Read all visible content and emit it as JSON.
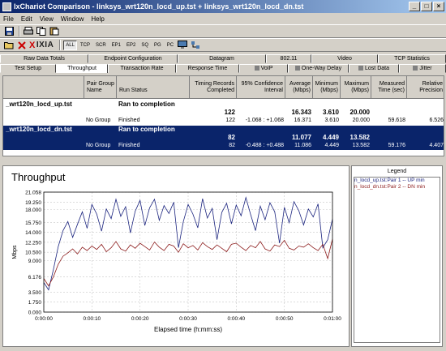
{
  "window": {
    "title": "IxChariot Comparison - linksys_wrt120n_locd_up.tst + linksys_wrt120n_locd_dn.tst",
    "minimize": "_",
    "maximize": "□",
    "close": "×"
  },
  "menu": [
    "File",
    "Edit",
    "View",
    "Window",
    "Help"
  ],
  "toolbar": {
    "brand_x": "X",
    "brand": "IXIA",
    "filters": [
      "ALL",
      "TCP",
      "SCR",
      "EP1",
      "EP2",
      "SQ",
      "PG",
      "PC"
    ]
  },
  "tabs_row1": [
    "Raw Data Totals",
    "Endpoint Configuration",
    "Datagram",
    "802.11",
    "Video",
    "TCP Statistics"
  ],
  "tabs_row2": [
    "Test Setup",
    "Throughput",
    "Transaction Rate",
    "Response Time",
    "VoIP",
    "One-Way Delay",
    "Lost Data",
    "Jitter"
  ],
  "grid": {
    "headers": {
      "pair_group": [
        "Pair Group",
        "Name"
      ],
      "run_status": "Run Status",
      "timing": [
        "Timing Records",
        "Completed"
      ],
      "confidence": [
        "95% Confidence",
        "Interval"
      ],
      "average": [
        "Average",
        "(Mbps)"
      ],
      "minimum": [
        "Minimum",
        "(Mbps)"
      ],
      "maximum": [
        "Maximum",
        "(Mbps)"
      ],
      "measured": [
        "Measured",
        "Time (sec)"
      ],
      "relative": [
        "Relative",
        "Precision"
      ]
    },
    "files": [
      {
        "name": "_wrt120n_locd_up.tst",
        "status": "Ran to completion",
        "total_records": "122",
        "total_avg": "16.343",
        "total_min": "3.610",
        "total_max": "20.000",
        "pair": {
          "group": "No Group",
          "status": "Finished",
          "records": "122",
          "conf": "-1.068 : +1.068",
          "avg": "16.371",
          "min": "3.610",
          "max": "20.000",
          "time": "59.618",
          "prec": "6.526"
        }
      },
      {
        "name": "_wrt120n_locd_dn.tst",
        "status": "Ran to completion",
        "total_records": "82",
        "total_avg": "11.077",
        "total_min": "4.449",
        "total_max": "13.582",
        "pair": {
          "group": "No Group",
          "status": "Finished",
          "records": "82",
          "conf": "-0.488 : +0.488",
          "avg": "11.086",
          "min": "4.449",
          "max": "13.582",
          "time": "59.176",
          "prec": "4.407"
        }
      }
    ]
  },
  "legend": {
    "title": "Legend",
    "items": [
      {
        "label": "n_locd_up.tst:Pair 1 -- UP min",
        "color": "#1a237e"
      },
      {
        "label": "n_locd_dn.tst:Pair 2 -- DN min",
        "color": "#8b1a1a"
      }
    ]
  },
  "chart_data": {
    "type": "line",
    "title": "Throughput",
    "xlabel": "Elapsed time (h:mm:ss)",
    "ylabel": "Mbps",
    "xlim": [
      0,
      60
    ],
    "ylim": [
      0,
      21.058
    ],
    "yticks": [
      "0.000",
      "1.750",
      "3.500",
      "6.176",
      "9.000",
      "10.500",
      "12.250",
      "14.000",
      "15.750",
      "18.000",
      "19.250",
      "21.058"
    ],
    "ytick_values": [
      0,
      1.75,
      3.5,
      6.176,
      9.0,
      10.5,
      12.25,
      14.0,
      15.75,
      18.0,
      19.25,
      21.058
    ],
    "xticks": [
      "0:00:00",
      "0:00:10",
      "0:00:20",
      "0:00:30",
      "0:00:40",
      "0:00:50",
      "0:01:00"
    ],
    "xtick_values": [
      0,
      10,
      20,
      30,
      40,
      50,
      60
    ],
    "series": [
      {
        "color": "#1a237e",
        "x": [
          0,
          1,
          2,
          3,
          4,
          5,
          6,
          7,
          8,
          9,
          10,
          11,
          12,
          13,
          14,
          15,
          16,
          17,
          18,
          19,
          20,
          21,
          22,
          23,
          24,
          25,
          26,
          27,
          28,
          29,
          30,
          31,
          32,
          33,
          34,
          35,
          36,
          37,
          38,
          39,
          40,
          41,
          42,
          43,
          44,
          45,
          46,
          47,
          48,
          49,
          50,
          51,
          52,
          53,
          54,
          55,
          56,
          57,
          58,
          59,
          60
        ],
        "y": [
          5.2,
          3.9,
          7.5,
          11.5,
          14.3,
          15.9,
          13.1,
          15.4,
          17.6,
          14.7,
          18.9,
          17.2,
          14.2,
          18.1,
          16.4,
          19.8,
          16.8,
          18.5,
          13.9,
          17.7,
          19.6,
          15.2,
          18.3,
          19.8,
          16.1,
          18.7,
          17.3,
          19.3,
          11.3,
          15.9,
          18.9,
          17.2,
          14.8,
          19.9,
          16.5,
          18.2,
          12.7,
          17.5,
          19.1,
          15.5,
          18.8,
          16.9,
          20.1,
          17.1,
          14.3,
          18.6,
          16.2,
          19.2,
          17.6,
          12.1,
          18.4,
          15.7,
          19.4,
          17.8,
          15.3,
          18.1,
          16.7,
          19.0,
          11.3,
          12.7,
          16.3
        ]
      },
      {
        "color": "#8b1a1a",
        "x": [
          0,
          1,
          2,
          3,
          4,
          5,
          6,
          7,
          8,
          9,
          10,
          11,
          12,
          13,
          14,
          15,
          16,
          17,
          18,
          19,
          20,
          21,
          22,
          23,
          24,
          25,
          26,
          27,
          28,
          29,
          30,
          31,
          32,
          33,
          34,
          35,
          36,
          37,
          38,
          39,
          40,
          41,
          42,
          43,
          44,
          45,
          46,
          47,
          48,
          49,
          50,
          51,
          52,
          53,
          54,
          55,
          56,
          57,
          58,
          59,
          60
        ],
        "y": [
          5.9,
          4.6,
          6.2,
          8.4,
          9.8,
          10.4,
          11.1,
          10.2,
          11.4,
          10.8,
          11.6,
          11.0,
          11.9,
          10.6,
          11.3,
          12.4,
          11.1,
          10.7,
          11.8,
          11.2,
          12.1,
          11.5,
          10.9,
          12.3,
          11.4,
          10.8,
          11.9,
          11.6,
          10.5,
          12.0,
          11.3,
          11.7,
          10.9,
          12.2,
          11.5,
          11.0,
          11.8,
          11.2,
          10.6,
          11.9,
          12.1,
          11.4,
          10.8,
          11.7,
          11.3,
          12.4,
          11.1,
          10.7,
          11.8,
          11.5,
          12.6,
          11.2,
          10.9,
          11.6,
          11.4,
          12.0,
          11.3,
          10.8,
          11.9,
          9.4,
          12.8
        ]
      }
    ]
  }
}
